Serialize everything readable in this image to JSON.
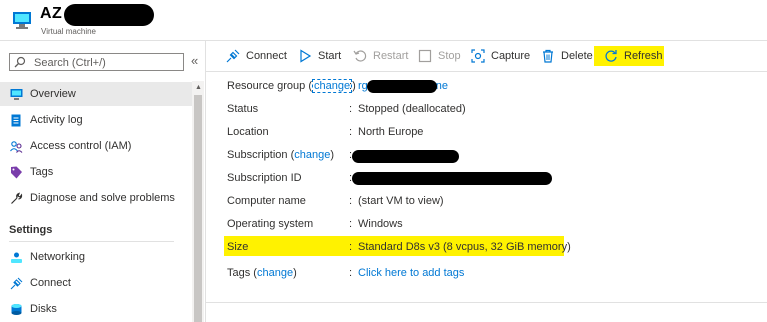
{
  "header": {
    "title": "AZ",
    "subtitle": "Virtual machine",
    "icon": "virtual-machine-icon"
  },
  "sidebar": {
    "search_placeholder": "Search (Ctrl+/)",
    "collapse_glyph": "«",
    "items": [
      {
        "label": "Overview",
        "icon": "monitor-icon",
        "active": true
      },
      {
        "label": "Activity log",
        "icon": "activity-log-icon"
      },
      {
        "label": "Access control (IAM)",
        "icon": "people-icon"
      },
      {
        "label": "Tags",
        "icon": "tag-icon"
      },
      {
        "label": "Diagnose and solve problems",
        "icon": "wrench-icon"
      }
    ],
    "section_title": "Settings",
    "settings_items": [
      {
        "label": "Networking",
        "icon": "networking-icon"
      },
      {
        "label": "Connect",
        "icon": "plug-icon"
      },
      {
        "label": "Disks",
        "icon": "disk-icon"
      }
    ]
  },
  "toolbar": {
    "connect": "Connect",
    "start": "Start",
    "restart": "Restart",
    "stop": "Stop",
    "capture": "Capture",
    "delete": "Delete",
    "refresh": "Refresh"
  },
  "properties": {
    "resource_group_label": "Resource group",
    "change": "change",
    "resource_group_value_start": "rg",
    "resource_group_value_end": "ne",
    "status_label": "Status",
    "status_value": "Stopped (deallocated)",
    "location_label": "Location",
    "location_value": "North Europe",
    "subscription_label": "Subscription",
    "subscription_id_label": "Subscription ID",
    "computer_name_label": "Computer name",
    "computer_name_value": "(start VM to view)",
    "os_label": "Operating system",
    "os_value": "Windows",
    "size_label": "Size",
    "size_value": "Standard D8s v3 (8 vcpus, 32 GiB memory)",
    "tags_label": "Tags",
    "tags_value": "Click here to add tags",
    "separator": ":"
  },
  "colors": {
    "link": "#0078d4",
    "highlight": "#fff200",
    "active_nav": "#e9e9e9"
  }
}
